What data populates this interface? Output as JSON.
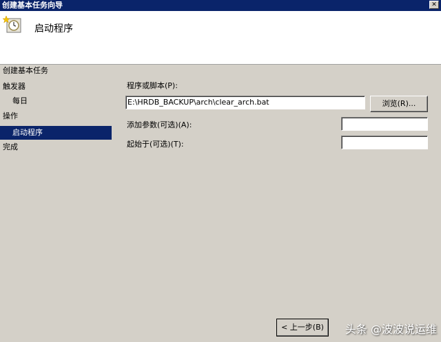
{
  "window": {
    "title": "创建基本任务向导"
  },
  "header": {
    "title": "启动程序"
  },
  "steps": {
    "heading": "创建基本任务",
    "items": [
      {
        "label": "触发器"
      },
      {
        "label": "每日"
      },
      {
        "label": "操作"
      },
      {
        "label": "启动程序"
      },
      {
        "label": "完成"
      }
    ]
  },
  "form": {
    "program_label": "程序或脚本(P):",
    "program_value": "E:\\HRDB_BACKUP\\arch\\clear_arch.bat",
    "browse_label": "浏览(R)...",
    "args_label": "添加参数(可选)(A):",
    "args_value": "",
    "startin_label": "起始于(可选)(T):",
    "startin_value": ""
  },
  "footer": {
    "back_label": "< 上一步(B)",
    "watermark": "头条 @波波说运维"
  },
  "colors": {
    "selection": "#0a246a",
    "titlebar": "#0a246a",
    "face": "#d4d0c8"
  }
}
